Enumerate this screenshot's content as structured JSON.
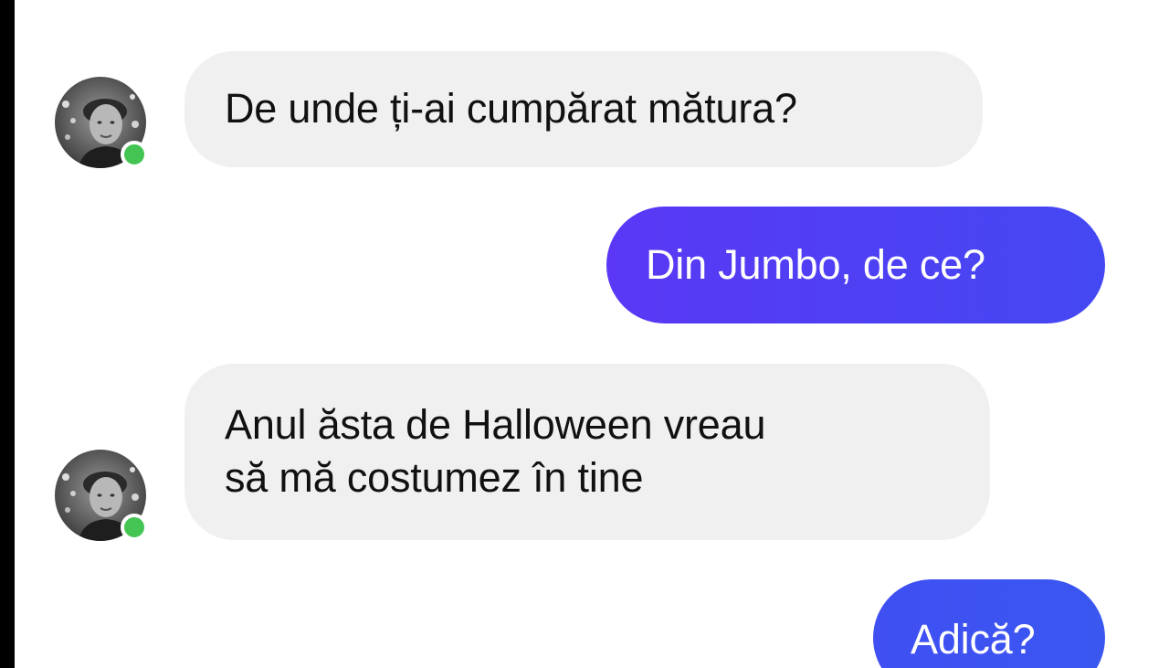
{
  "conversation": {
    "messages": [
      {
        "direction": "incoming",
        "lines": [
          "De unde ți-ai cumpărat mătura?"
        ]
      },
      {
        "direction": "outgoing",
        "lines": [
          "Din Jumbo, de ce?"
        ]
      },
      {
        "direction": "incoming",
        "lines": [
          "Anul ăsta de Halloween vreau",
          "să mă costumez în tine"
        ]
      },
      {
        "direction": "outgoing",
        "lines": [
          "Adică?"
        ]
      }
    ]
  },
  "contact": {
    "online_status": "online"
  },
  "colors": {
    "incoming_bubble": "#f0f0f0",
    "outgoing_bubble_start": "#5a38f5",
    "outgoing_bubble_end": "#3a57f0",
    "online_dot": "#44c553"
  },
  "icons": {
    "avatar": "avatar-photo",
    "online": "online-dot-icon"
  }
}
